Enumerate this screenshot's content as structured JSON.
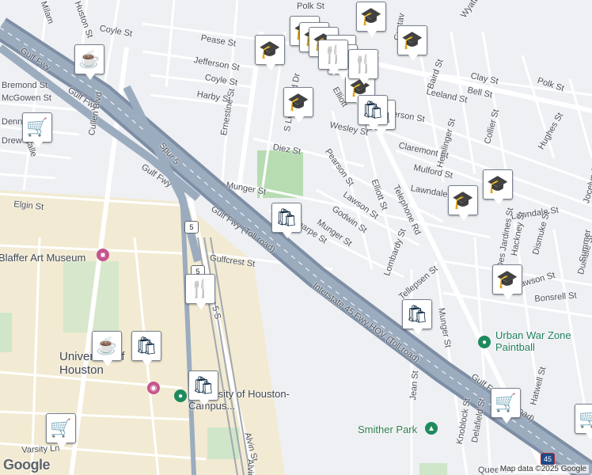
{
  "map": {
    "attribution": "Map data ©2025 Google",
    "logo": "Google",
    "colors": {
      "background": "#eef0f3",
      "freeway": "#8a9bb0",
      "road": "#ffffff",
      "park": "#b7dcb2",
      "campus": "#f2ead2",
      "rail": "#a3a8b0",
      "pin_icon": "#0e2a44",
      "poi_green": "#1e8a5e",
      "poi_pink": "#c5548e"
    }
  },
  "streets": [
    {
      "name": "Polk St"
    },
    {
      "name": "Coyle St"
    },
    {
      "name": "Pease St"
    },
    {
      "name": "Jefferson St"
    },
    {
      "name": "Coyle St"
    },
    {
      "name": "Harby St"
    },
    {
      "name": "Gulf Fwy"
    },
    {
      "name": "Gulf Fwy"
    },
    {
      "name": "Gulf Fwy"
    },
    {
      "name": "Spur 5"
    },
    {
      "name": "Cullen Blvd"
    },
    {
      "name": "Ernestine St"
    },
    {
      "name": "S Lockwood Dr"
    },
    {
      "name": "Diez St"
    },
    {
      "name": "Munger St"
    },
    {
      "name": "Elgin St"
    },
    {
      "name": "Gulf Fwy (Toll road)"
    },
    {
      "name": "Scharpe St"
    },
    {
      "name": "Gulfcrest St"
    },
    {
      "name": "Spur 5 S"
    },
    {
      "name": "Pearson St"
    },
    {
      "name": "Lawson St"
    },
    {
      "name": "Godwin St"
    },
    {
      "name": "Munger St"
    },
    {
      "name": "Elliott St"
    },
    {
      "name": "Lombardy St"
    },
    {
      "name": "Telephone Rd"
    },
    {
      "name": "Wesley St"
    },
    {
      "name": "Jefferson St"
    },
    {
      "name": "Claremont St"
    },
    {
      "name": "Mulford St"
    },
    {
      "name": "Lawndale St"
    },
    {
      "name": "Lawndale St"
    },
    {
      "name": "Polk St"
    },
    {
      "name": "Leeland St"
    },
    {
      "name": "Bell St"
    },
    {
      "name": "Clay St"
    },
    {
      "name": "Wyatt St"
    },
    {
      "name": "Baird St"
    },
    {
      "name": "Hemlinger St"
    },
    {
      "name": "Collier St"
    },
    {
      "name": "Hughes St"
    },
    {
      "name": "Interstate 45 Fwy HOV (Toll road)"
    },
    {
      "name": "Gulf Fwy (Toll road)"
    },
    {
      "name": "Tellepsen St"
    },
    {
      "name": "Munger St"
    },
    {
      "name": "Jean St"
    },
    {
      "name": "Knoblock St"
    },
    {
      "name": "Delafield St"
    },
    {
      "name": "Hatwell St"
    },
    {
      "name": "Bonsrell St"
    },
    {
      "name": "Dismuke St"
    },
    {
      "name": "Dumble St"
    },
    {
      "name": "Lawson St"
    },
    {
      "name": "Des Jardines St"
    },
    {
      "name": "Hackney St"
    },
    {
      "name": "Jocelyn St"
    },
    {
      "name": "Varsity Ln"
    },
    {
      "name": "Alvin St"
    },
    {
      "name": "Bremond St"
    },
    {
      "name": "McGowen St"
    },
    {
      "name": "Dennis St"
    },
    {
      "name": "Drew St"
    },
    {
      "name": "Calle"
    },
    {
      "name": "Milam"
    },
    {
      "name": "Huston St"
    },
    {
      "name": "Gustav"
    },
    {
      "name": "Elliott"
    },
    {
      "name": "Queens"
    },
    {
      "name": "Summer"
    },
    {
      "name": "Alvin Fwy"
    }
  ],
  "places": {
    "museum": "Blaffer Art Museum",
    "university": "University of Houston",
    "campus": "University of Houston-Campus...",
    "paintball": "Urban War Zone Paintball",
    "park": "Smither Park"
  },
  "route_shields": [
    "5",
    "5",
    "45"
  ],
  "pins": [
    {
      "kind": "school",
      "icon": "school-icon"
    },
    {
      "kind": "school",
      "icon": "school-icon"
    },
    {
      "kind": "school",
      "icon": "school-icon"
    },
    {
      "kind": "school",
      "icon": "school-icon"
    },
    {
      "kind": "school",
      "icon": "school-icon"
    },
    {
      "kind": "school",
      "icon": "school-icon"
    },
    {
      "kind": "school",
      "icon": "school-icon"
    },
    {
      "kind": "school",
      "icon": "school-icon"
    },
    {
      "kind": "school",
      "icon": "school-icon"
    },
    {
      "kind": "school",
      "icon": "school-icon"
    },
    {
      "kind": "school",
      "icon": "school-icon"
    },
    {
      "kind": "shopping",
      "icon": "shopping-bag-icon"
    },
    {
      "kind": "shopping",
      "icon": "shopping-bag-icon"
    },
    {
      "kind": "shopping",
      "icon": "shopping-bag-icon"
    },
    {
      "kind": "shopping",
      "icon": "shopping-bag-icon"
    },
    {
      "kind": "shopping",
      "icon": "shopping-bag-icon"
    },
    {
      "kind": "shopping",
      "icon": "shopping-bag-icon"
    },
    {
      "kind": "shopping",
      "icon": "shopping-bag-icon"
    },
    {
      "kind": "restaurant",
      "icon": "restaurant-icon"
    },
    {
      "kind": "restaurant",
      "icon": "restaurant-icon"
    },
    {
      "kind": "restaurant",
      "icon": "restaurant-icon"
    },
    {
      "kind": "restaurant",
      "icon": "restaurant-icon"
    },
    {
      "kind": "cafe",
      "icon": "coffee-cup-icon"
    },
    {
      "kind": "cafe",
      "icon": "coffee-cup-icon"
    },
    {
      "kind": "grocery",
      "icon": "shopping-cart-icon"
    },
    {
      "kind": "grocery",
      "icon": "shopping-cart-icon"
    },
    {
      "kind": "grocery",
      "icon": "shopping-cart-icon"
    },
    {
      "kind": "grocery",
      "icon": "shopping-cart-icon"
    }
  ]
}
